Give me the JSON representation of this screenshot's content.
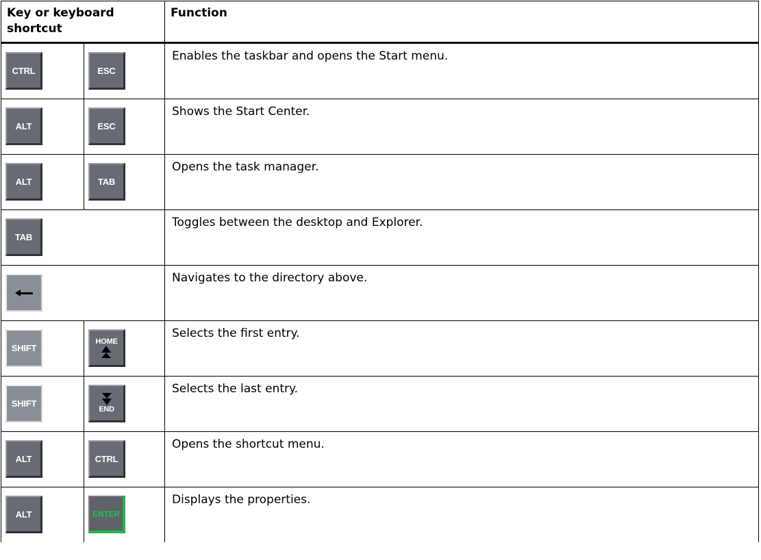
{
  "table": {
    "headers": {
      "key": "Key or keyboard shortcut",
      "function": "Function"
    },
    "rows": [
      {
        "keys": [
          "CTRL",
          "ESC"
        ],
        "function": "Enables the taskbar and opens the Start menu."
      },
      {
        "keys": [
          "ALT",
          "ESC"
        ],
        "function": "Shows the Start Center."
      },
      {
        "keys": [
          "ALT",
          "TAB"
        ],
        "function": "Opens the task manager."
      },
      {
        "keys": [
          "TAB"
        ],
        "function": "Toggles between the desktop and Explorer."
      },
      {
        "keys": [
          "back-arrow-icon"
        ],
        "function": "Navigates to the directory above."
      },
      {
        "keys": [
          "SHIFT",
          "HOME"
        ],
        "function": "Selects the first entry."
      },
      {
        "keys": [
          "SHIFT",
          "END"
        ],
        "function": "Selects the last entry."
      },
      {
        "keys": [
          "ALT",
          "CTRL"
        ],
        "function": "Opens the shortcut menu."
      },
      {
        "keys": [
          "ALT",
          "ENTER"
        ],
        "function": "Displays the properties."
      }
    ]
  },
  "colors": {
    "key_cap": "#686b73",
    "enter_key_accent": "#22c24f"
  }
}
